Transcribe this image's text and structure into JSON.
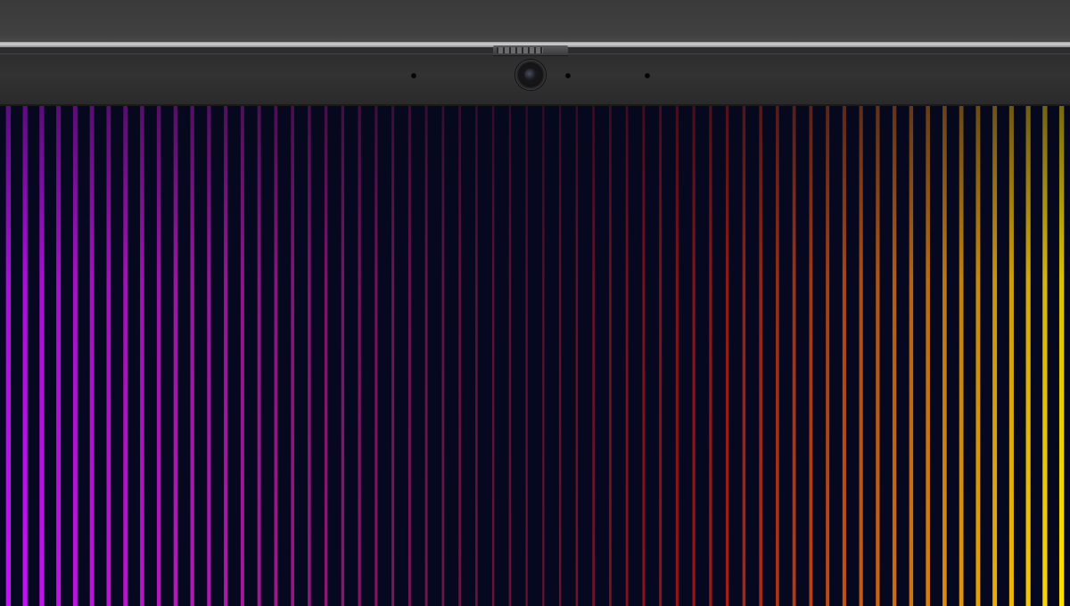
{
  "scene": {
    "subject": "laptop-top-bezel-with-webcam",
    "wallpaper": {
      "style": "vertical-stripes",
      "background": "#05081f",
      "stripe_count": 64,
      "gradient_stops": [
        {
          "pos": 0.0,
          "color": "#c410ff"
        },
        {
          "pos": 0.2,
          "color": "#e31fd8"
        },
        {
          "pos": 0.45,
          "color": "#c8205a"
        },
        {
          "pos": 0.65,
          "color": "#ff1a10"
        },
        {
          "pos": 0.85,
          "color": "#ff8a10"
        },
        {
          "pos": 1.0,
          "color": "#ffe600"
        }
      ]
    },
    "icons": {
      "webcam": "webcam-icon",
      "shutter": "privacy-shutter-icon"
    }
  }
}
